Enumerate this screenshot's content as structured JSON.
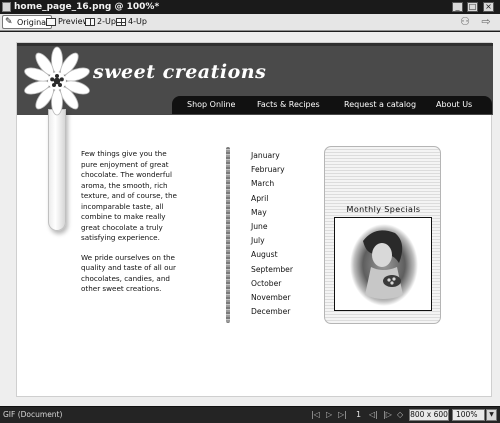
{
  "window": {
    "title": "home_page_16.png @ 100%*",
    "minimize_glyph": "_",
    "maximize_glyph": "□",
    "close_glyph": "×"
  },
  "toolbar": {
    "tabs": [
      {
        "label": "Original",
        "icon": "pencil-icon",
        "active": true
      },
      {
        "label": "Preview",
        "icon": "preview-icon",
        "active": false
      },
      {
        "label": "2-Up",
        "icon": "two-up-icon",
        "active": false
      },
      {
        "label": "4-Up",
        "icon": "four-up-icon",
        "active": false
      }
    ],
    "right_icons": [
      "people-icon",
      "export-icon"
    ]
  },
  "site": {
    "brand": "sweet creations",
    "nav": [
      "Shop Online",
      "Facts & Recipes",
      "Request a catalog",
      "About Us"
    ],
    "intro": [
      "Few things give you the pure enjoyment of great chocolate. The wonderful aroma, the smooth, rich texture, and of course, the incomparable taste, all combine to make really great chocolate a truly satisfying experience.",
      "We pride ourselves on the quality and taste of all our chocolates, candies, and other sweet creations."
    ],
    "months": [
      "January",
      "February",
      "March",
      "April",
      "May",
      "June",
      "July",
      "August",
      "September",
      "October",
      "November",
      "December"
    ],
    "specials_title": "Monthly Specials"
  },
  "status": {
    "doc_type": "GIF (Document)",
    "frame": "1",
    "dimensions": "800 x 600",
    "zoom": "100%",
    "zoom_arrow": "▼",
    "playback": {
      "first": "|◁",
      "play": "▷",
      "last": "▷|",
      "prev": "◁|",
      "next": "|▷",
      "loop": "◇"
    }
  }
}
